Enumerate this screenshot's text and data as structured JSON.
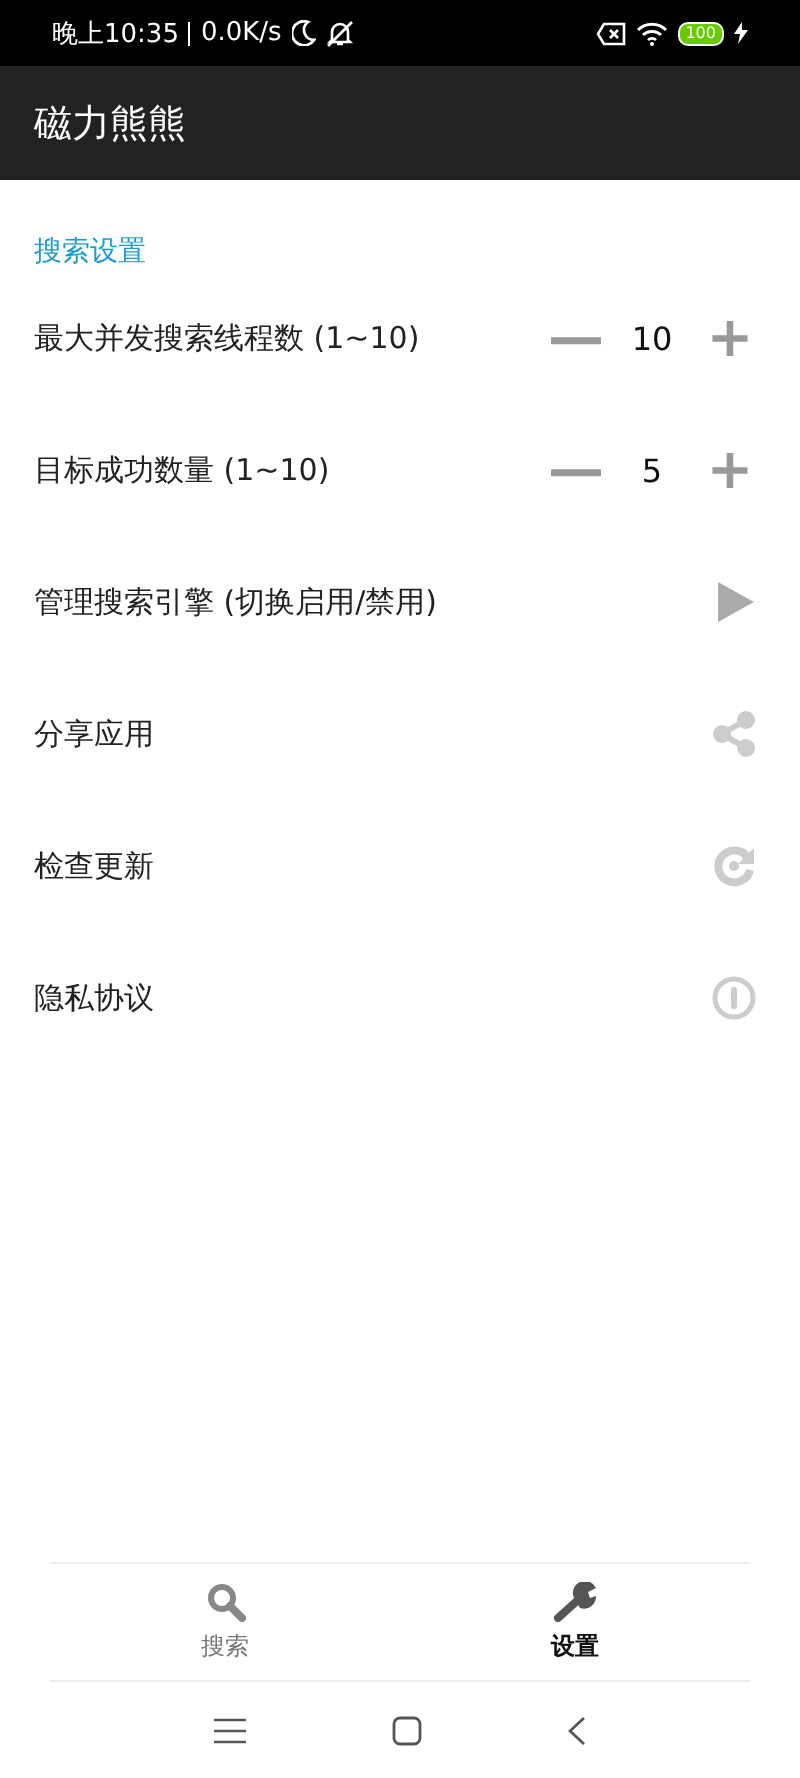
{
  "status_bar": {
    "time": "晚上10:35",
    "speed": "0.0K/s",
    "battery": "100"
  },
  "app_bar": {
    "title": "磁力熊熊"
  },
  "section": {
    "title": "搜索设置"
  },
  "settings": [
    {
      "kind": "stepper",
      "label": "最大并发搜索线程数 (1~10)",
      "value": "10",
      "minus": "—",
      "plus": "+"
    },
    {
      "kind": "stepper",
      "label": "目标成功数量 (1~10)",
      "value": "5",
      "minus": "—",
      "plus": "+"
    },
    {
      "kind": "link",
      "label": "管理搜索引擎 (切换启用/禁用)"
    },
    {
      "kind": "link",
      "label": "分享应用"
    },
    {
      "kind": "link",
      "label": "检查更新"
    },
    {
      "kind": "link",
      "label": "隐私协议"
    }
  ],
  "bottom_nav": [
    {
      "label": "搜索",
      "selected": false
    },
    {
      "label": "设置",
      "selected": true
    }
  ]
}
